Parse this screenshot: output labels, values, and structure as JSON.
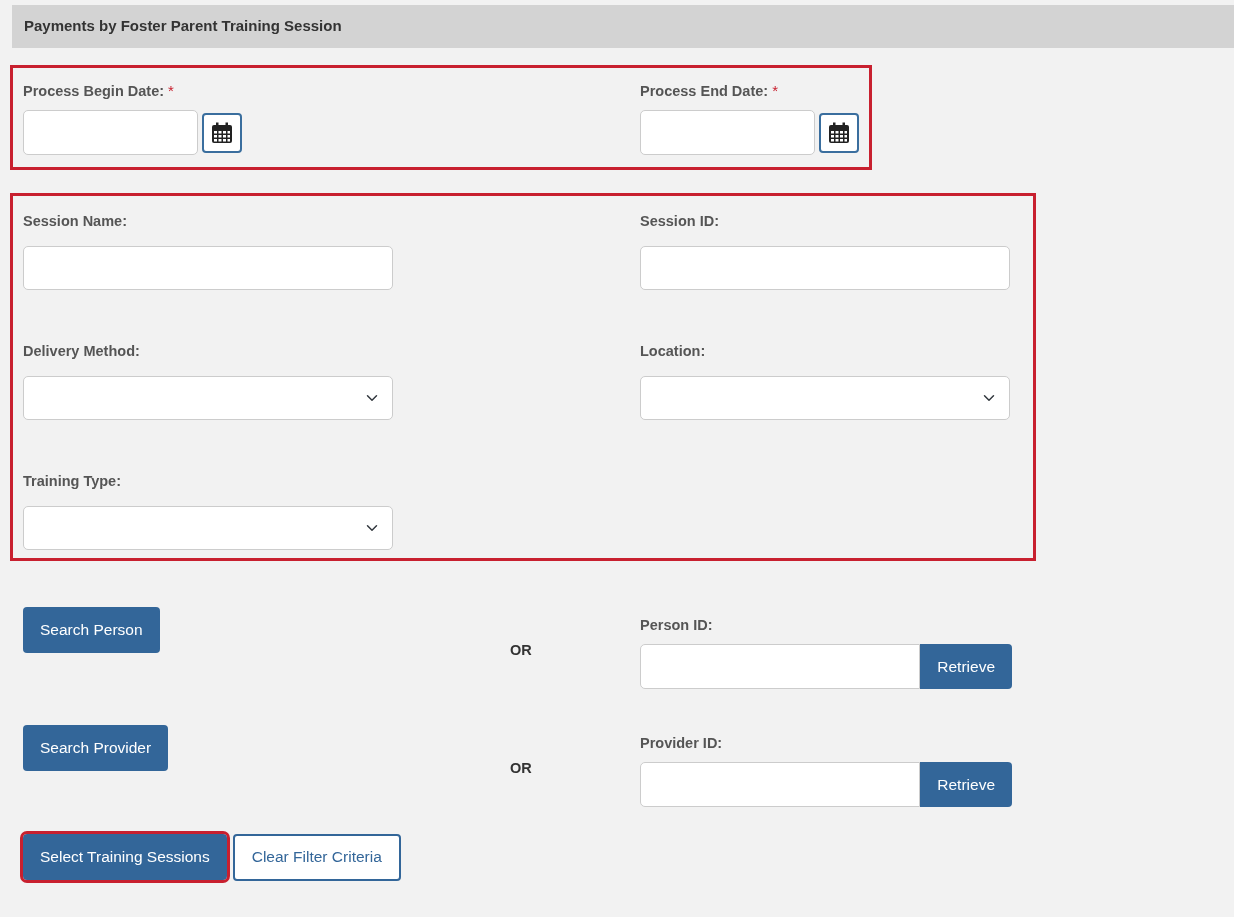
{
  "title": "Payments by Foster Parent Training Session",
  "date_section": {
    "highlighted": true,
    "fields": [
      {
        "label": "Process Begin Date:",
        "required_mark": "*"
      },
      {
        "label": "Process End Date:",
        "required_mark": "*"
      }
    ]
  },
  "filters": {
    "highlighted": true,
    "fields": [
      {
        "kind": "text",
        "label": "Session Name:"
      },
      {
        "kind": "text",
        "label": "Session ID:"
      },
      {
        "kind": "select",
        "label": "Delivery Method:"
      },
      {
        "kind": "select",
        "label": "Location:"
      },
      {
        "kind": "select",
        "label": "Training Type:"
      }
    ]
  },
  "lookups": [
    {
      "button": "Search Person",
      "separator": "OR",
      "label": "Person ID:",
      "action": "Retrieve"
    },
    {
      "button": "Search Provider",
      "separator": "OR",
      "label": "Provider ID:",
      "action": "Retrieve"
    }
  ],
  "actions": [
    {
      "kind": "primary",
      "label": "Select Training Sessions",
      "highlighted": true
    },
    {
      "kind": "outline",
      "label": "Clear Filter Criteria",
      "highlighted": false
    }
  ]
}
